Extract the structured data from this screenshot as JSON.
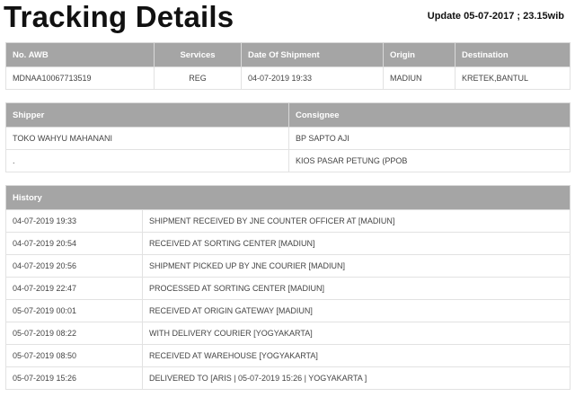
{
  "page": {
    "title": "Tracking Details",
    "update": "Update 05-07-2017 ; 23.15wib"
  },
  "shipment": {
    "headers": {
      "awb": "No. AWB",
      "services": "Services",
      "date": "Date Of Shipment",
      "origin": "Origin",
      "destination": "Destination"
    },
    "row": {
      "awb": "MDNAA10067713519",
      "services": "REG",
      "date": "04-07-2019 19:33",
      "origin": "MADIUN",
      "destination": "KRETEK,BANTUL"
    }
  },
  "parties": {
    "headers": {
      "shipper": "Shipper",
      "consignee": "Consignee"
    },
    "rows": [
      {
        "shipper": "TOKO WAHYU MAHANANI",
        "consignee": "BP SAPTO AJI"
      },
      {
        "shipper": ".",
        "consignee": "KIOS PASAR PETUNG (PPOB"
      }
    ]
  },
  "history": {
    "header": "History",
    "rows": [
      {
        "time": "04-07-2019 19:33",
        "event": "SHIPMENT RECEIVED BY JNE COUNTER OFFICER AT [MADIUN]"
      },
      {
        "time": "04-07-2019 20:54",
        "event": "RECEIVED AT SORTING CENTER [MADIUN]"
      },
      {
        "time": "04-07-2019 20:56",
        "event": "SHIPMENT PICKED UP BY JNE COURIER [MADIUN]"
      },
      {
        "time": "04-07-2019 22:47",
        "event": "PROCESSED AT SORTING CENTER [MADIUN]"
      },
      {
        "time": "05-07-2019 00:01",
        "event": "RECEIVED AT ORIGIN GATEWAY [MADIUN]"
      },
      {
        "time": "05-07-2019 08:22",
        "event": "WITH DELIVERY COURIER [YOGYAKARTA]"
      },
      {
        "time": "05-07-2019 08:50",
        "event": "RECEIVED AT WAREHOUSE [YOGYAKARTA]"
      },
      {
        "time": "05-07-2019 15:26",
        "event": "DELIVERED TO [ARIS | 05-07-2019 15:26 | YOGYAKARTA ]"
      }
    ]
  }
}
